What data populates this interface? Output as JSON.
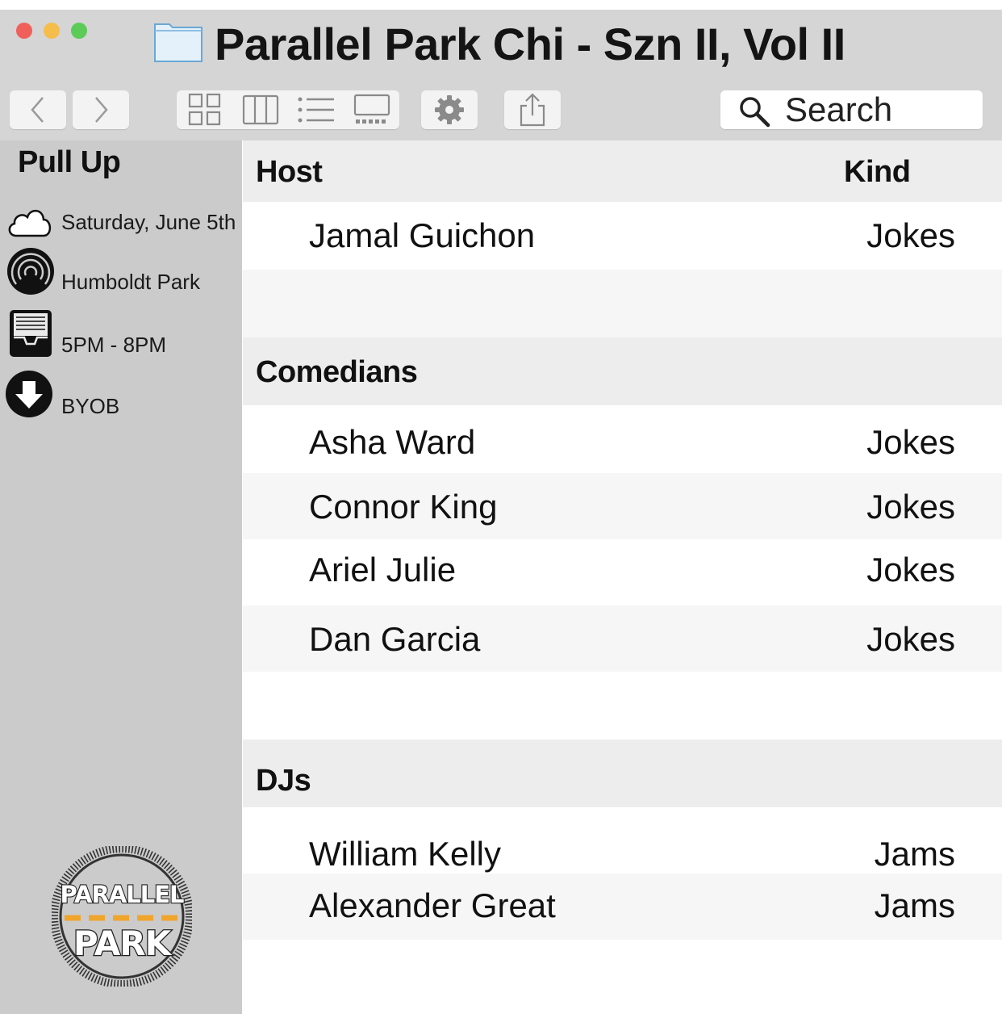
{
  "window": {
    "title": "Parallel Park Chi - Szn II, Vol II"
  },
  "toolbar": {
    "back_icon": "chevron-left-icon",
    "forward_icon": "chevron-right-icon",
    "view_icons": [
      "icon-view-icon",
      "column-view-icon",
      "list-view-icon",
      "gallery-view-icon"
    ],
    "action_icon": "gear-icon",
    "share_icon": "share-icon",
    "search_placeholder": "Search"
  },
  "sidebar": {
    "title": "Pull Up",
    "items": [
      {
        "label": "Saturday, June 5th",
        "icon": "cloud-icon"
      },
      {
        "label": "Humboldt Park",
        "icon": "airdrop-icon"
      },
      {
        "label": "5PM - 8PM",
        "icon": "inbox-tray-icon"
      },
      {
        "label": "BYOB",
        "icon": "download-arrow-icon"
      }
    ],
    "logo": {
      "line1": "PARALLEL",
      "line2": "PARK",
      "accent": "#f0a52c"
    }
  },
  "list": {
    "columns": {
      "name": "Host",
      "kind": "Kind"
    },
    "host": [
      {
        "name": "Jamal Guichon",
        "kind": "Jokes"
      }
    ],
    "comedians_header": "Comedians",
    "comedians": [
      {
        "name": "Asha Ward",
        "kind": "Jokes"
      },
      {
        "name": "Connor King",
        "kind": "Jokes"
      },
      {
        "name": "Ariel Julie",
        "kind": "Jokes"
      },
      {
        "name": "Dan Garcia",
        "kind": "Jokes"
      }
    ],
    "djs_header": "DJs",
    "djs": [
      {
        "name": "William Kelly",
        "kind": "Jams"
      },
      {
        "name": "Alexander Great",
        "kind": "Jams"
      }
    ]
  },
  "colors": {
    "titlebar": "#d5d5d5",
    "sidebar": "#cbcbcb",
    "close": "#f0605a",
    "minimize": "#f5be4c",
    "zoom": "#5ccb57"
  }
}
